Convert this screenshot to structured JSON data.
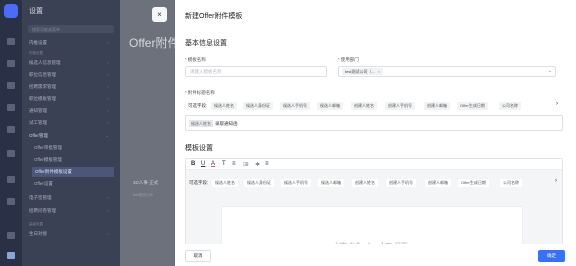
{
  "sidemenu": {
    "title": "设置",
    "search_placeholder": "搜索功能或菜单",
    "groups": [
      "内推设置",
      "高级设置"
    ],
    "items": [
      {
        "label": "内推设置"
      },
      {
        "label": "候选人信息管理"
      },
      {
        "label": "职位信息管理"
      },
      {
        "label": "招聘需求管理"
      },
      {
        "label": "职位模板管理"
      },
      {
        "label": "通知管理"
      },
      {
        "label": "试工管理"
      },
      {
        "label": "Offer管理"
      },
      {
        "label": "电子签管理"
      },
      {
        "label": "招聘问卷管理"
      },
      {
        "label": "生日对接"
      }
    ],
    "offer_sub": [
      "Offer审批管理",
      "Offer模板管理",
      "Offer附件模板设置",
      "Offer设置"
    ],
    "bottom_group": "高级设置"
  },
  "main": {
    "title": "Offer附件",
    "row_label": "3D人事-正式",
    "row_sub": "test测试公司"
  },
  "drawer": {
    "close_icon": "×",
    "title": "新建Offer附件模板",
    "basic_section": "基本信息设置",
    "template_name_label": "模板名称",
    "template_name_placeholder": "请输入模板名称",
    "department_label": "使用部门",
    "department_tag": "test测试公司（...",
    "attachment_name_label": "附件标题名称",
    "var_label": "可选字段:",
    "variables": [
      "候选人姓名",
      "候选人身份证",
      "候选人手机号",
      "候选人邮箱",
      "创建人姓名",
      "创建人手机号",
      "创建人邮箱",
      "Offer生成日期",
      "公司名称"
    ],
    "name_chip": "候选人姓名",
    "name_suffix": "录取通知函",
    "template_section": "模板设置",
    "toolbar": [
      "B",
      "U",
      "A",
      "T",
      "≡",
      "⁝≡",
      "≑",
      "≡"
    ],
    "editor_placeholder": "请输入标题",
    "cancel_label": "取消",
    "ok_label": "确定"
  }
}
